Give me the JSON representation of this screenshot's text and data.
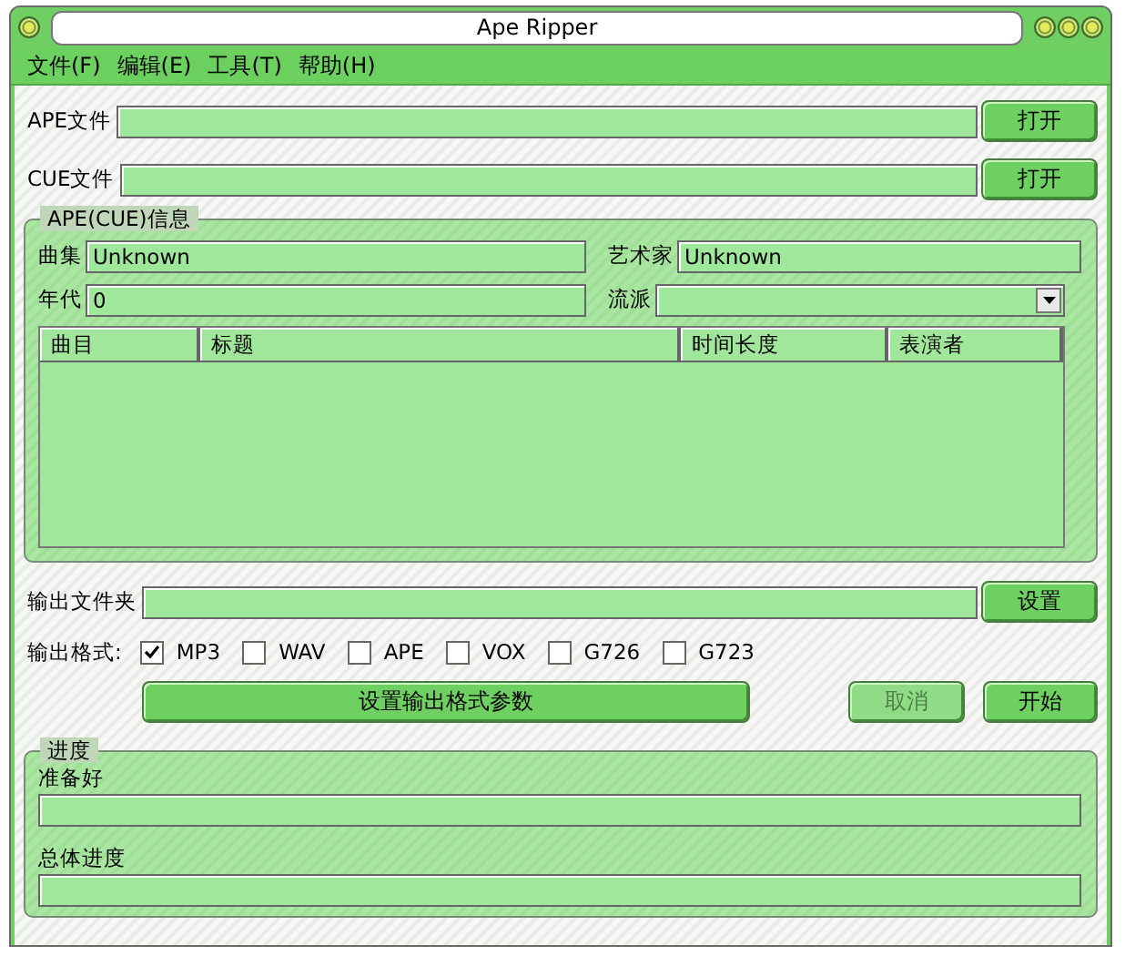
{
  "window": {
    "title": "Ape Ripper"
  },
  "menu": [
    "文件(F)",
    "编辑(E)",
    "工具(T)",
    "帮助(H)"
  ],
  "file_rows": [
    {
      "label": "APE文件",
      "button": "打开"
    },
    {
      "label": "CUE文件",
      "button": "打开"
    }
  ],
  "info_group": {
    "title": "APE(CUE)信息",
    "fields": [
      {
        "label": "曲集",
        "value": "Unknown",
        "kind": "text"
      },
      {
        "label": "艺术家",
        "value": "Unknown",
        "kind": "text"
      },
      {
        "label": "年代",
        "value": "0",
        "kind": "text"
      },
      {
        "label": "流派",
        "kind": "combo"
      }
    ],
    "table": {
      "columns": [
        "曲目",
        "标题",
        "时间长度",
        "表演者"
      ]
    }
  },
  "output_folder": {
    "label": "输出文件夹",
    "button": "设置"
  },
  "output_format": {
    "label": "输出格式:",
    "options": [
      {
        "label": "MP3",
        "checked": true
      },
      {
        "label": "WAV",
        "checked": false
      },
      {
        "label": "APE",
        "checked": false
      },
      {
        "label": "VOX",
        "checked": false
      },
      {
        "label": "G726",
        "checked": false
      },
      {
        "label": "G723",
        "checked": false
      }
    ]
  },
  "actions": [
    {
      "label": "设置输出格式参数",
      "disabled": false,
      "kind": "wide"
    },
    {
      "label": "取消",
      "disabled": true,
      "kind": "small"
    },
    {
      "label": "开始",
      "disabled": false,
      "kind": "small"
    }
  ],
  "progress_group": {
    "title": "进度",
    "bars": [
      {
        "label": "准备好",
        "level": 0
      },
      {
        "label": "总体进度",
        "level": 0
      }
    ]
  }
}
